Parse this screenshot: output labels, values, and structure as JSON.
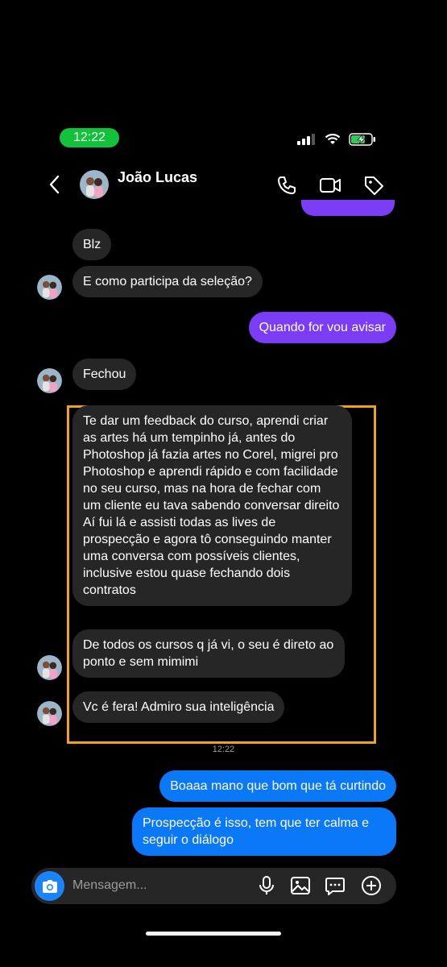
{
  "status_bar": {
    "time": "12:22"
  },
  "header": {
    "contact_name": "João Lucas"
  },
  "messages": [
    {
      "text": "Blz"
    },
    {
      "text": "E como participa da seleção?"
    },
    {
      "text": "Quando for vou avisar"
    },
    {
      "text": "Fechou"
    },
    {
      "text": "Te dar um feedback do curso, aprendi criar as artes há um tempinho já, antes do Photoshop já fazia artes no Corel, migrei pro Photoshop e aprendi rápido e com facilidade no seu curso, mas na hora de fechar com um cliente eu tava sabendo conversar direito\nAí fui lá e assisti todas as lives de prospecção e agora tô conseguindo manter uma conversa com possíveis clientes, inclusive estou quase fechando dois contratos"
    },
    {
      "text": "De todos os cursos q já vi, o seu é direto ao ponto e sem mimimi"
    },
    {
      "text": "Vc é fera! Admiro sua inteligência"
    },
    {
      "text": "Boaaa mano que bom que tá curtindo"
    },
    {
      "text": "Prospecção é isso, tem que ter calma e seguir o diálogo"
    }
  ],
  "timestamp": "12:22",
  "composer": {
    "placeholder": "Mensagem..."
  },
  "colors": {
    "incoming": "#262626",
    "outgoing_purple": "#7b3cf5",
    "outgoing_blue": "#0b78f7",
    "highlight": "#f0a21a"
  }
}
